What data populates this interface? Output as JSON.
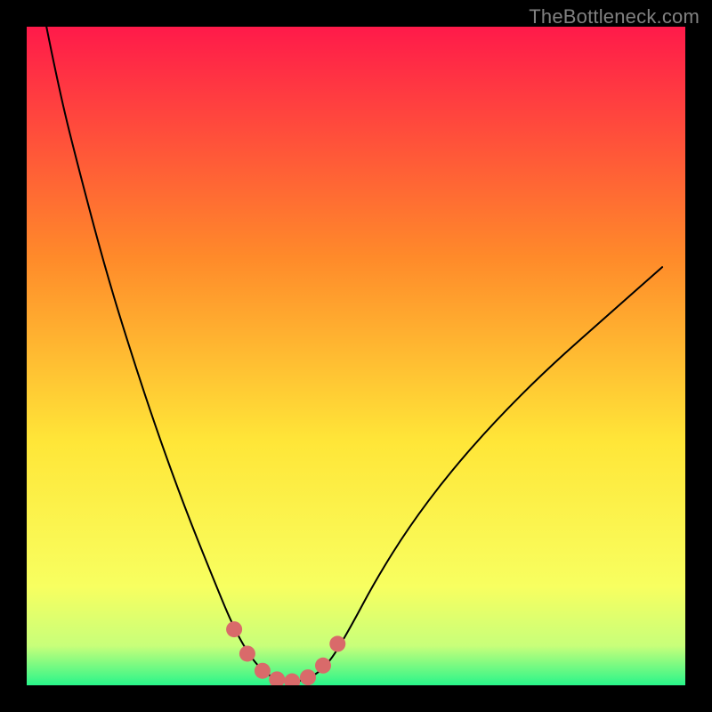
{
  "watermark": "TheBottleneck.com",
  "colors": {
    "page_bg": "#000000",
    "grad_top": "#ff1a4a",
    "grad_upper_mid": "#ff8a2a",
    "grad_mid": "#ffe638",
    "grad_lower": "#f8ff60",
    "grad_near_bottom": "#c8ff7a",
    "grad_bottom": "#29f58a",
    "curve": "#000000",
    "marker_fill": "#d96a6a"
  },
  "chart_data": {
    "type": "line",
    "title": "",
    "xlabel": "",
    "ylabel": "",
    "xlim": [
      0,
      1
    ],
    "ylim": [
      0,
      1
    ],
    "series": [
      {
        "name": "bottleneck-curve",
        "x": [
          0.03,
          0.05,
          0.08,
          0.12,
          0.16,
          0.2,
          0.24,
          0.28,
          0.315,
          0.345,
          0.37,
          0.39,
          0.41,
          0.435,
          0.46,
          0.49,
          0.53,
          0.58,
          0.64,
          0.71,
          0.79,
          0.88,
          0.965
        ],
        "y": [
          1.0,
          0.9,
          0.78,
          0.63,
          0.5,
          0.38,
          0.27,
          0.17,
          0.085,
          0.035,
          0.013,
          0.005,
          0.005,
          0.013,
          0.035,
          0.085,
          0.16,
          0.24,
          0.32,
          0.4,
          0.48,
          0.56,
          0.635
        ]
      }
    ],
    "markers": {
      "name": "highlight-dots",
      "x": [
        0.315,
        0.335,
        0.358,
        0.38,
        0.403,
        0.427,
        0.45,
        0.472
      ],
      "y": [
        0.085,
        0.048,
        0.022,
        0.009,
        0.006,
        0.012,
        0.03,
        0.063
      ]
    }
  }
}
